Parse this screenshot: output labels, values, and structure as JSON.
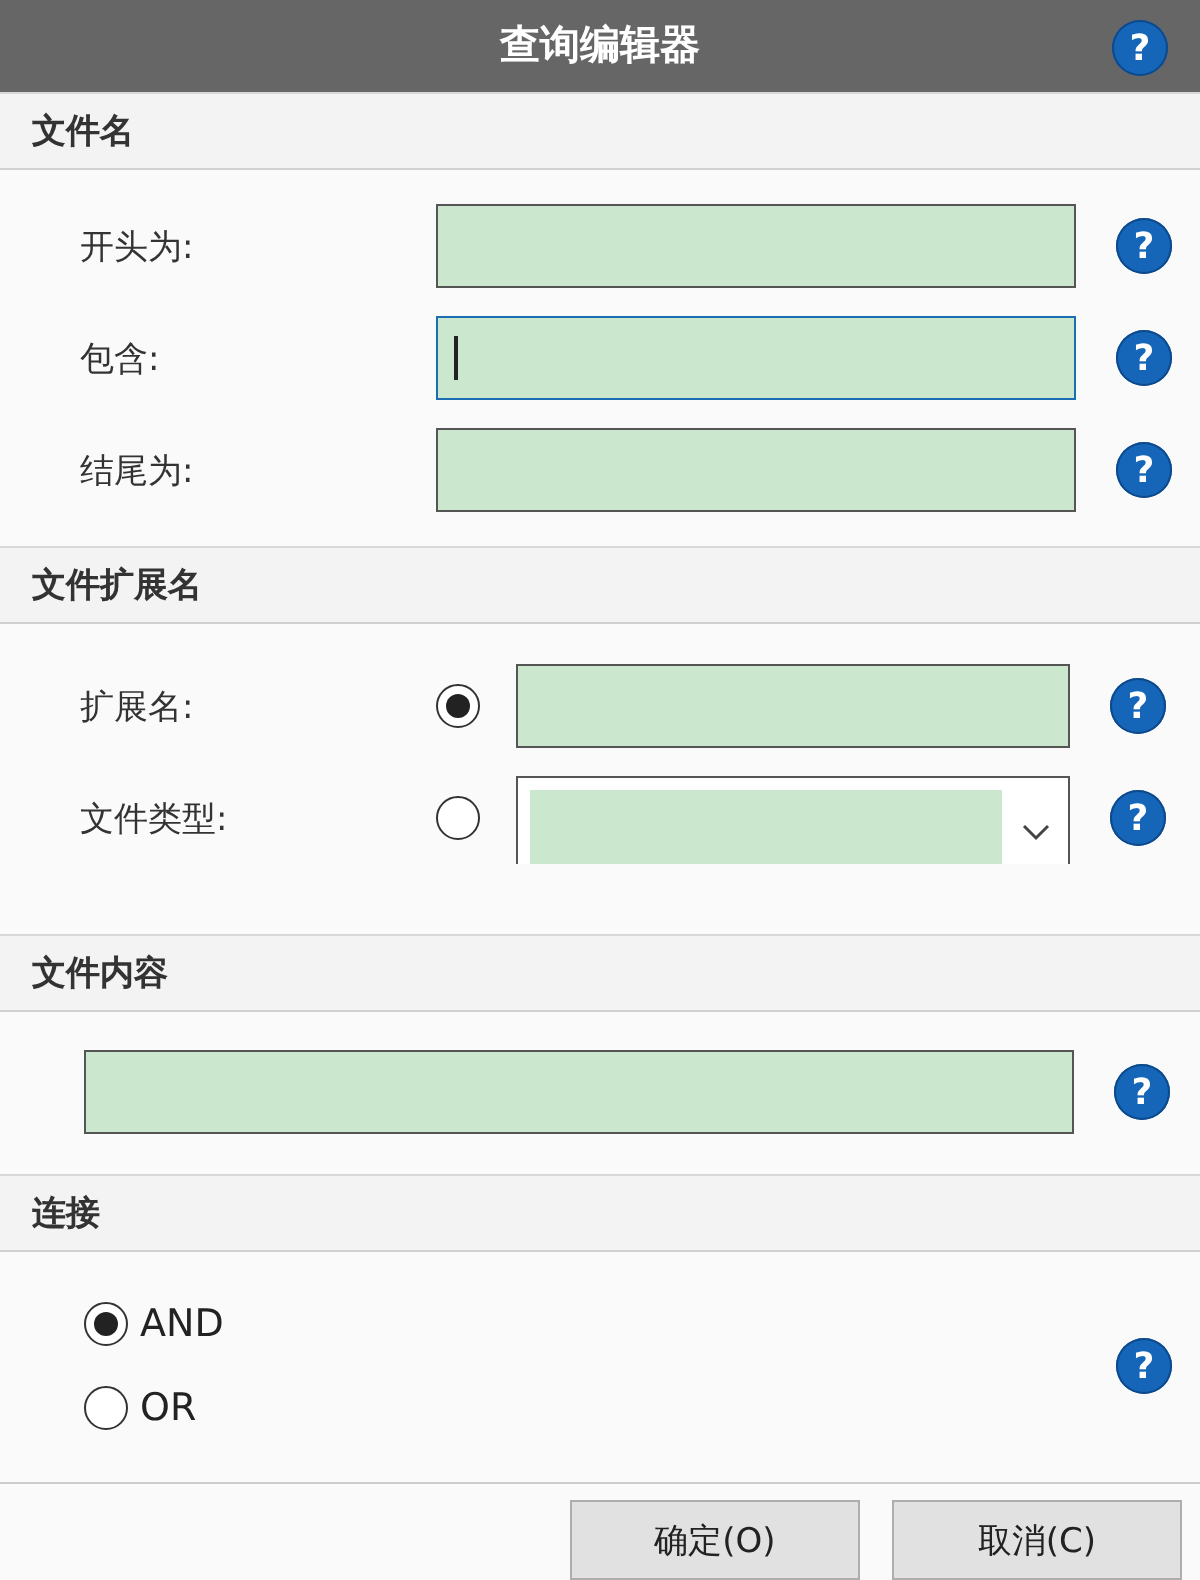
{
  "window": {
    "title": "查询编辑器",
    "help": "?"
  },
  "sections": [
    {
      "title": "文件名",
      "kind": "fields",
      "rows": [
        {
          "label": "开头为:",
          "focused": false,
          "help": "?"
        },
        {
          "label": "包含:",
          "focused": true,
          "help": "?"
        },
        {
          "label": "结尾为:",
          "focused": false,
          "help": "?"
        }
      ]
    },
    {
      "title": "文件扩展名",
      "kind": "choice",
      "rows": [
        {
          "label": "扩展名:",
          "kind": "text",
          "selected": true,
          "help": "?"
        },
        {
          "label": "文件类型:",
          "kind": "dropdown",
          "selected": false,
          "help": "?"
        }
      ]
    },
    {
      "title": "文件内容",
      "kind": "content",
      "help": "?"
    },
    {
      "title": "连接",
      "kind": "connect",
      "help": "?",
      "options": [
        {
          "label": "AND",
          "selected": true
        },
        {
          "label": "OR",
          "selected": false
        }
      ]
    }
  ],
  "buttons": [
    "确定(O)",
    "取消(C)"
  ]
}
